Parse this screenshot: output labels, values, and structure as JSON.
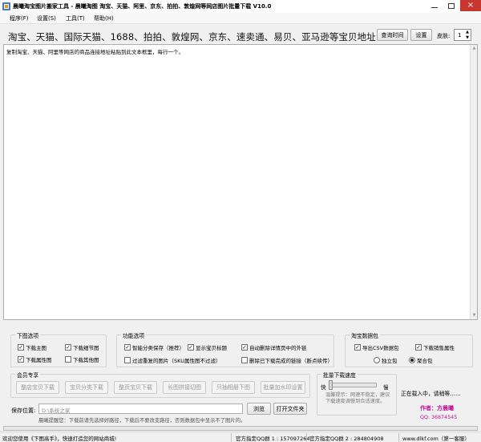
{
  "window": {
    "title": "晨曦淘宝图片搬家工具 - 晨曦淘图 淘宝、天猫、阿里、京东、拍拍、敦煌网等网店图片批量下载 V10.0",
    "close_symbol": "×"
  },
  "menu": {
    "items": [
      "程序(F)",
      "设置(S)",
      "工具(T)",
      "帮助(H)"
    ]
  },
  "url_bar": {
    "label": "淘宝、天猫、国际天猫、1688、拍拍、敦煌网、京东、速卖通、易贝、亚马逊等宝贝地址:",
    "query_time_label": "查询时间",
    "settings_label": "设置",
    "skin_label": "皮肤:",
    "skin_value": "1"
  },
  "url_input": {
    "placeholder": "复制淘宝、天猫、阿里等网店的商品连接地址粘贴到此文本框里，每行一个。"
  },
  "download_options": {
    "title": "下图选项",
    "items": [
      {
        "label": "下载主图",
        "checked": true
      },
      {
        "label": "下载细节图",
        "checked": true
      },
      {
        "label": "下载属性图",
        "checked": true
      },
      {
        "label": "下载其他图",
        "checked": false
      }
    ]
  },
  "function_options": {
    "title": "功能选项",
    "items": [
      {
        "label": "智能分类保存（推荐）",
        "checked": true
      },
      {
        "label": "显示宝贝标题",
        "checked": true
      },
      {
        "label": "自动删除详情页中的外链",
        "checked": true
      },
      {
        "label": "过滤重复的图片（SKU属性图不过滤）",
        "checked": false
      },
      {
        "label": "删除已下载完成的链接（断点续传）",
        "checked": false
      }
    ]
  },
  "data_pack": {
    "title": "淘宝数据包",
    "export_csv": {
      "label": "导出CSV数据包",
      "checked": true
    },
    "sales_attr": {
      "label": "下载销售属性",
      "checked": true
    },
    "standalone": {
      "label": "独立包",
      "checked": false
    },
    "combined": {
      "label": "聚合包",
      "checked": true
    }
  },
  "member": {
    "title": "会员专享",
    "buttons": [
      "整店宝贝下载",
      "宝贝分类下载",
      "整页宝贝下载",
      "长图拼接切图",
      "只抽相册下图",
      "批量加水印设置"
    ]
  },
  "speed": {
    "title": "批量下载速度",
    "fast": "快",
    "slow": "慢",
    "level": 0.0,
    "note": "温馨提示：网速不稳定，建议下载速度调慢到合适速度。"
  },
  "save": {
    "label": "保存位置:",
    "path": "D:\\系统之家",
    "browse_label": "浏览",
    "open_folder_label": "打开文件夹",
    "tip": "晨曦提醒您：下载前请先选择好路径，下载后不要改变路径，否则数据包中显示不了图片的。"
  },
  "status": {
    "loading": "正在载入中，请稍等……",
    "author": "作者：方晨曦",
    "qq": "QQ: 36874545",
    "promo": "欢迎您使用《下图高手》，快速打造您的网站商城!",
    "group1": "官方指定QQ群 1 : 157097264",
    "group2": "官方指定QQ群 2 : 284804908",
    "site": "www.dlkf.com（第一客服）"
  },
  "colors": {
    "author_accent": "#c0139b",
    "close_button": "#c7372f"
  }
}
